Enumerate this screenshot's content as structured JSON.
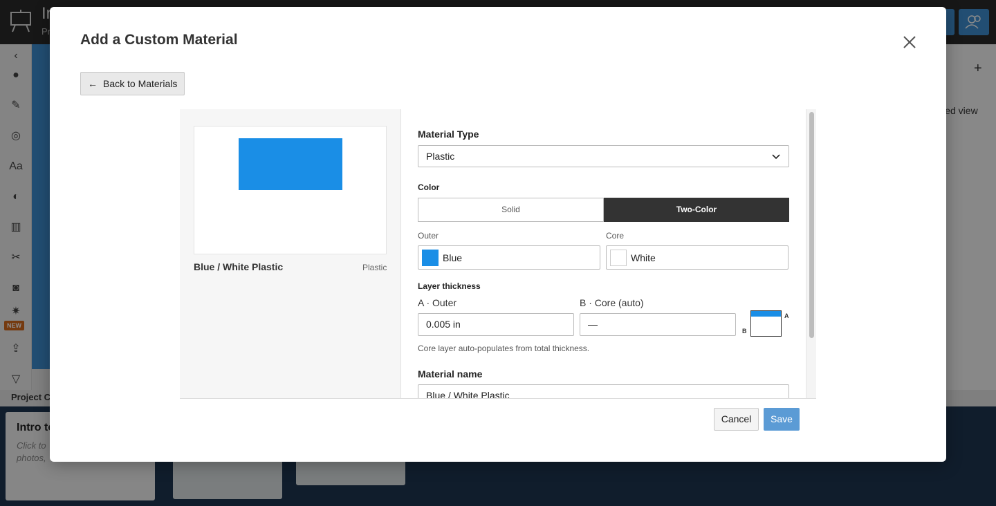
{
  "background": {
    "title": "In",
    "subtitle": "Pr",
    "detailed_view": "iled view",
    "new_badge": "NEW",
    "project_label": "Project C",
    "card_title": "Intro to",
    "card_desc_1": "Click to",
    "card_desc_2": "photos,"
  },
  "modal": {
    "title": "Add a Custom Material",
    "back_label": "Back to Materials",
    "preview": {
      "name": "Blue / White Plastic",
      "type": "Plastic"
    },
    "material_type": {
      "label": "Material Type",
      "value": "Plastic"
    },
    "color": {
      "label": "Color",
      "options": [
        "Solid",
        "Two-Color"
      ],
      "selected": "Two-Color",
      "outer_label": "Outer",
      "outer_value": "Blue",
      "core_label": "Core",
      "core_value": "White"
    },
    "layer_thickness": {
      "label": "Layer thickness",
      "outer_label": "A · Outer",
      "outer_value": "0.005 in",
      "core_label": "B · Core (auto)",
      "core_value": "—",
      "diagram_a": "A",
      "diagram_b": "B",
      "help": "Core layer auto-populates from total thickness."
    },
    "material_name": {
      "label": "Material name",
      "value": "Blue / White Plastic"
    },
    "cancel_label": "Cancel",
    "save_label": "Save"
  },
  "colors": {
    "accent": "#3f8fd2",
    "outer_blue": "#1a8ee6",
    "core_white": "#ffffff",
    "save_button": "#5b9bd5",
    "dark_segment": "#333333"
  },
  "icons": {
    "close": "close-icon",
    "back": "arrow-left-icon",
    "dropdown": "chevron-down-icon"
  }
}
